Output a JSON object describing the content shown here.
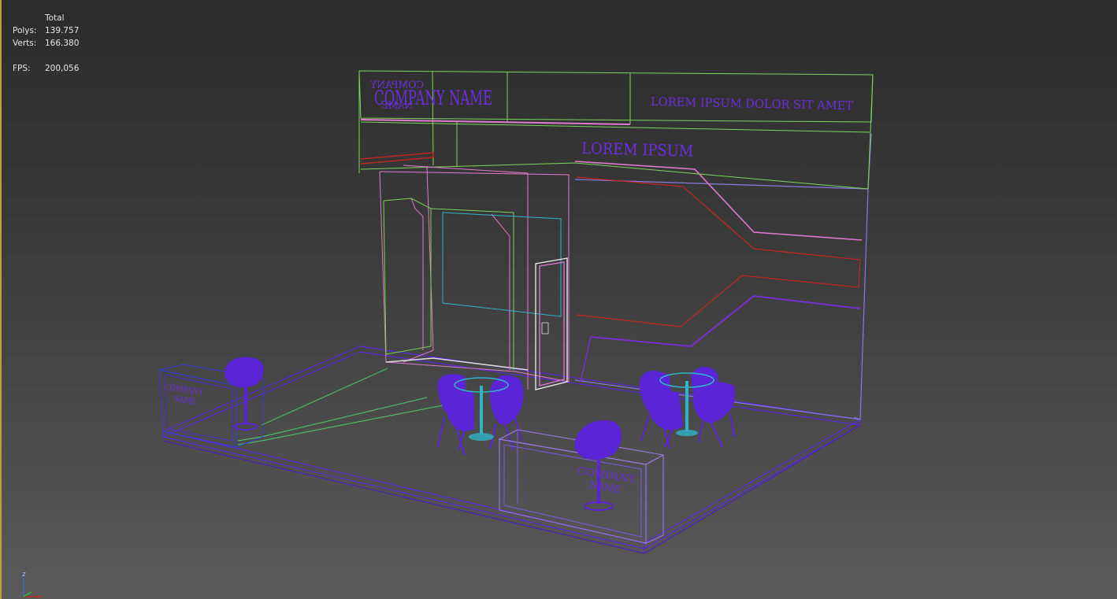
{
  "stats": {
    "total_label": "Total",
    "polys_label": "Polys:",
    "polys_value": "139.757",
    "verts_label": "Verts:",
    "verts_value": "166.380",
    "fps_label": "FPS:",
    "fps_value": "200,056"
  },
  "signage": {
    "company_name": "COMPANY NAME",
    "company_mirrored_top": "COMPANY",
    "company_mirrored_bottom": "NAME",
    "headline_right": "LOREM IPSUM DOLOR SIT AMET",
    "headline_mid": "LOREM IPSUM",
    "left_counter_line1": "COMPANY",
    "left_counter_line2": "NAME",
    "front_counter_line1": "COMPANY",
    "front_counter_line2": "NAME"
  },
  "axis_gizmo": {
    "z_label": "z"
  },
  "colors": {
    "wire_green": "#7fd35a",
    "wire_pink": "#e07ad0",
    "wire_red": "#c0281e",
    "wire_purple": "#6b2fe0",
    "wire_cyan": "#2fb4c8",
    "furniture": "#5a25d6",
    "accent_gold": "#b9a23a"
  }
}
